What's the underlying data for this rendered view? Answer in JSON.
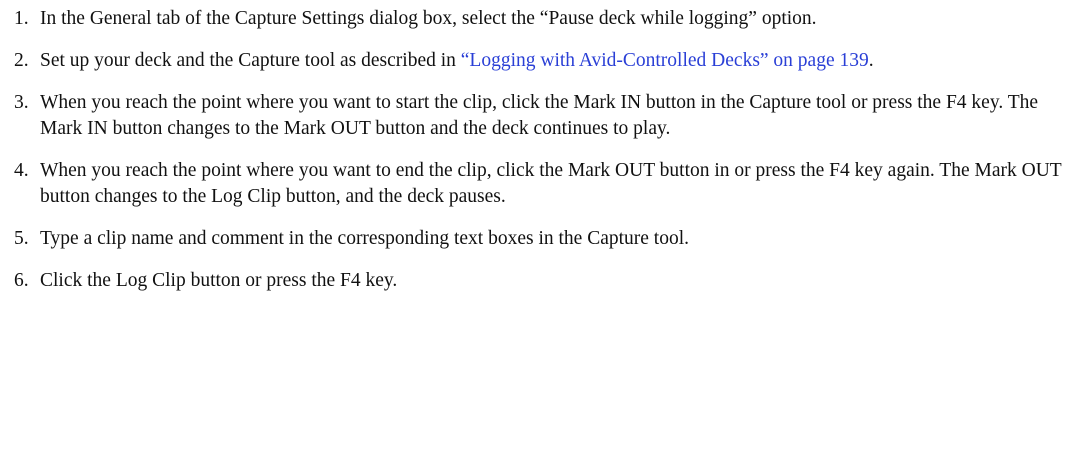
{
  "steps": [
    {
      "number": "1.",
      "text": "In the General tab of the Capture Settings dialog box, select the “Pause deck while logging” option."
    },
    {
      "number": "2.",
      "before": "Set up your deck and the Capture tool as described in ",
      "link": "“Logging with Avid-Controlled Decks” on page 139",
      "after": "."
    },
    {
      "number": "3.",
      "text": "When you reach the point where you want to start the clip, click the Mark IN button in the Capture tool or press the F4 key. The Mark IN button changes to the Mark OUT button and the deck continues to play."
    },
    {
      "number": "4.",
      "text": "When you reach the point where you want to end the clip, click the Mark OUT button in or press the F4 key again. The Mark OUT button changes to the Log Clip button, and the deck pauses."
    },
    {
      "number": "5.",
      "text": "Type a clip name and comment in the corresponding text boxes in the Capture tool."
    },
    {
      "number": "6.",
      "text": "Click the Log Clip button or press the F4 key."
    }
  ],
  "colors": {
    "link": "#2a3fd6",
    "text": "#111111"
  }
}
